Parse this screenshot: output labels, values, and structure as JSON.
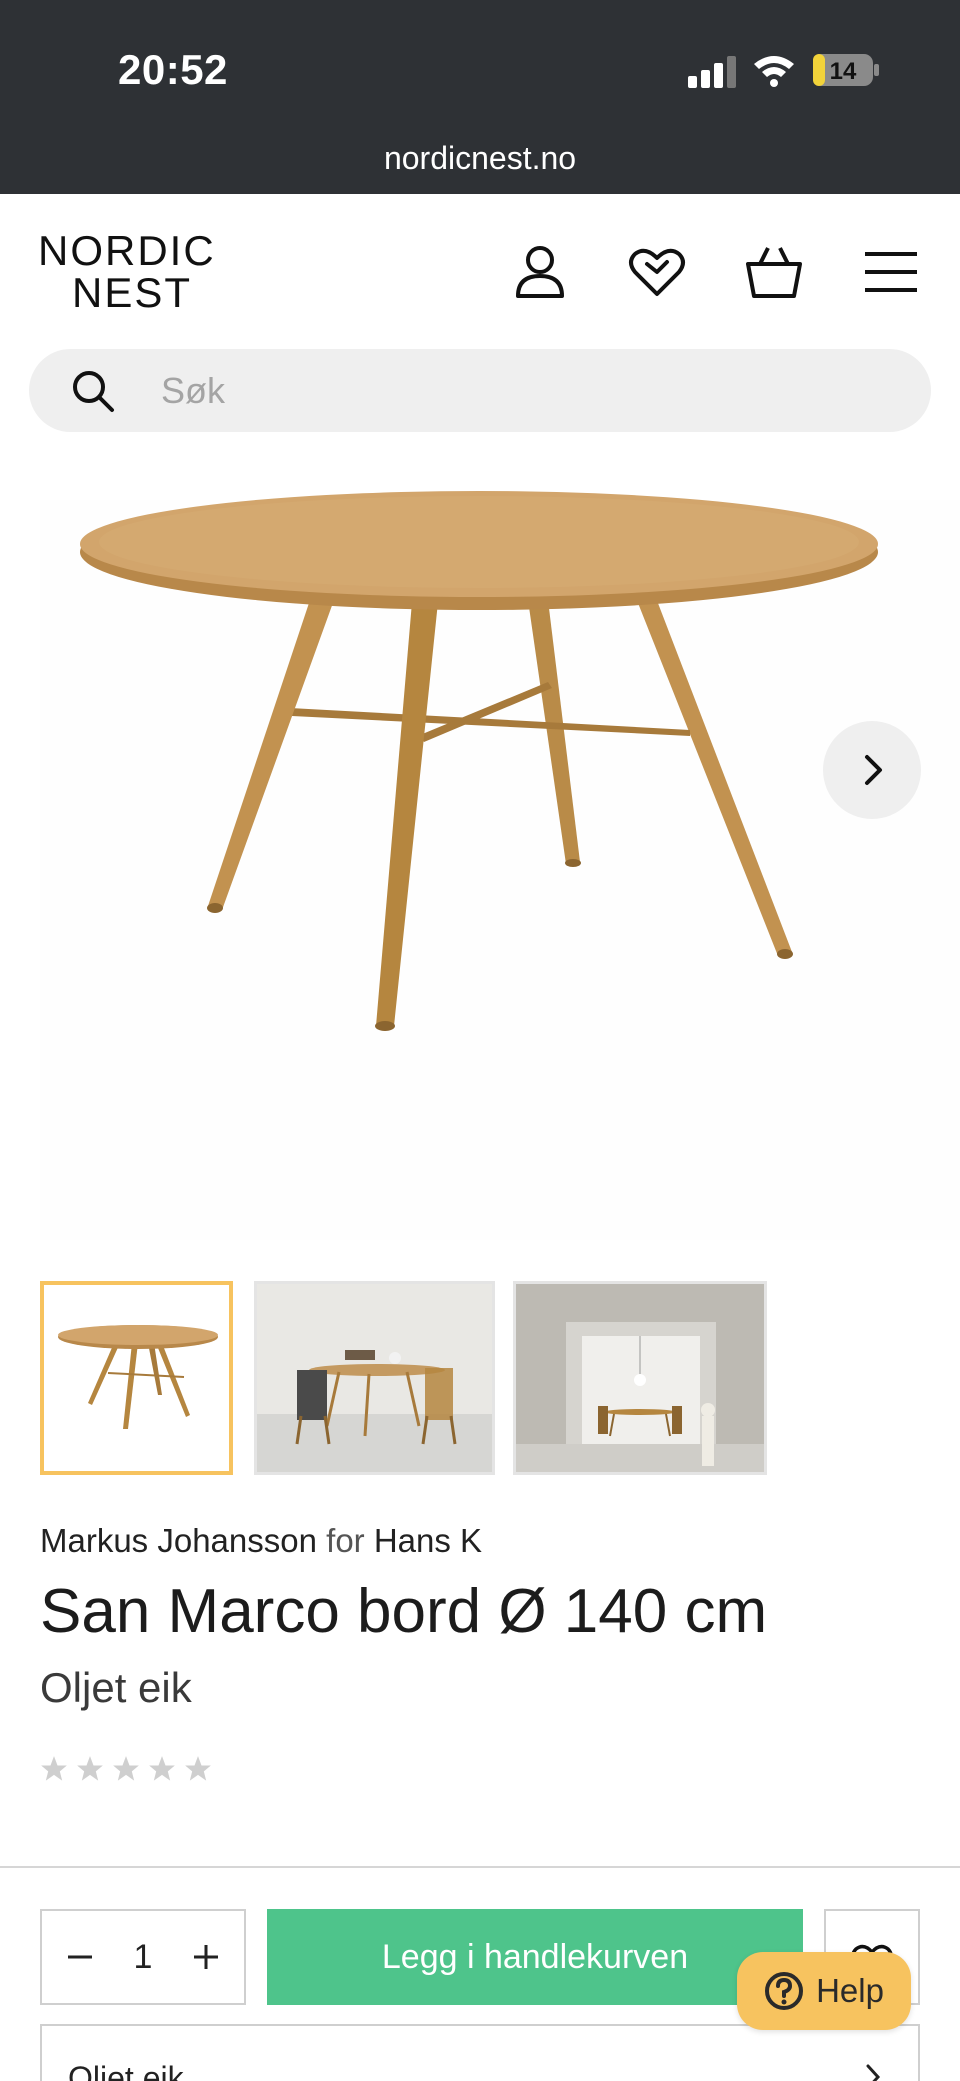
{
  "status_bar": {
    "time": "20:52",
    "battery": "14",
    "url": "nordicnest.no",
    "icons": [
      "signal-icon",
      "wifi-icon",
      "battery-icon"
    ]
  },
  "header": {
    "logo_line1": "NORDIC",
    "logo_line2": "NEST",
    "icons": [
      "user-icon",
      "heart-icon",
      "basket-icon",
      "menu-icon"
    ]
  },
  "search": {
    "placeholder": "Søk",
    "icon": "search-icon"
  },
  "gallery": {
    "next_icon": "chevron-right-icon",
    "thumbnails": [
      "Round table",
      "Dining room scene",
      "Room through doorway"
    ],
    "selected_index": 0
  },
  "product": {
    "designer": "Markus Johansson",
    "for_text": "for",
    "manufacturer": "Hans K",
    "title": "San Marco bord Ø 140 cm",
    "variant": "Oljet eik",
    "rating": 0,
    "max_rating": 5
  },
  "purchase": {
    "quantity": "1",
    "add_to_cart_label": "Legg i handlekurven",
    "help_label": "Help",
    "variant_select_label": "Oljet eik"
  },
  "colors": {
    "status_bar_bg": "#2e3135",
    "accent_green": "#4ec48b",
    "help_yellow": "#f7c35f",
    "selected_thumb_border": "#f7c35f"
  }
}
